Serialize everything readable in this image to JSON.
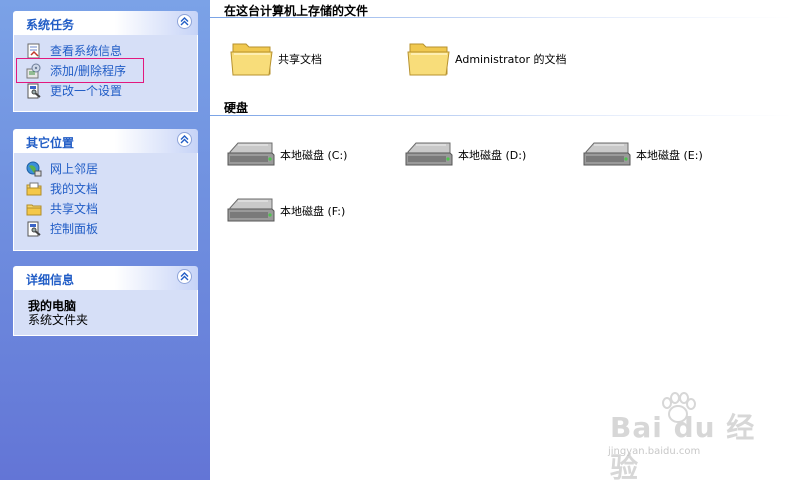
{
  "sidebar": {
    "system_tasks": {
      "title": "系统任务",
      "items": [
        {
          "label": "查看系统信息",
          "icon": "system-info-icon"
        },
        {
          "label": "添加/删除程序",
          "icon": "add-remove-programs-icon"
        },
        {
          "label": "更改一个设置",
          "icon": "change-setting-icon"
        }
      ]
    },
    "other_places": {
      "title": "其它位置",
      "items": [
        {
          "label": "网上邻居",
          "icon": "network-places-icon"
        },
        {
          "label": "我的文档",
          "icon": "my-documents-icon"
        },
        {
          "label": "共享文档",
          "icon": "shared-documents-icon"
        },
        {
          "label": "控制面板",
          "icon": "control-panel-icon"
        }
      ]
    },
    "details": {
      "title": "详细信息",
      "name": "我的电脑",
      "type": "系统文件夹"
    }
  },
  "main": {
    "files_group": {
      "title": "在这台计算机上存储的文件",
      "items": [
        {
          "label": "共享文档"
        },
        {
          "label": "Administrator 的文档"
        }
      ]
    },
    "drives_group": {
      "title": "硬盘",
      "items": [
        {
          "label": "本地磁盘 (C:)"
        },
        {
          "label": "本地磁盘 (D:)"
        },
        {
          "label": "本地磁盘 (E:)"
        },
        {
          "label": "本地磁盘 (F:)"
        }
      ]
    }
  },
  "watermark": {
    "brand": "Bai du 经验",
    "url": "jingyan.baidu.com"
  },
  "colors": {
    "sidebar_top": "#7ba2e7",
    "sidebar_bottom": "#6375d6",
    "panel_title": "#215dc6",
    "link": "#215dc6",
    "panel_body": "#d6dff7",
    "highlight": "#e2187e"
  }
}
